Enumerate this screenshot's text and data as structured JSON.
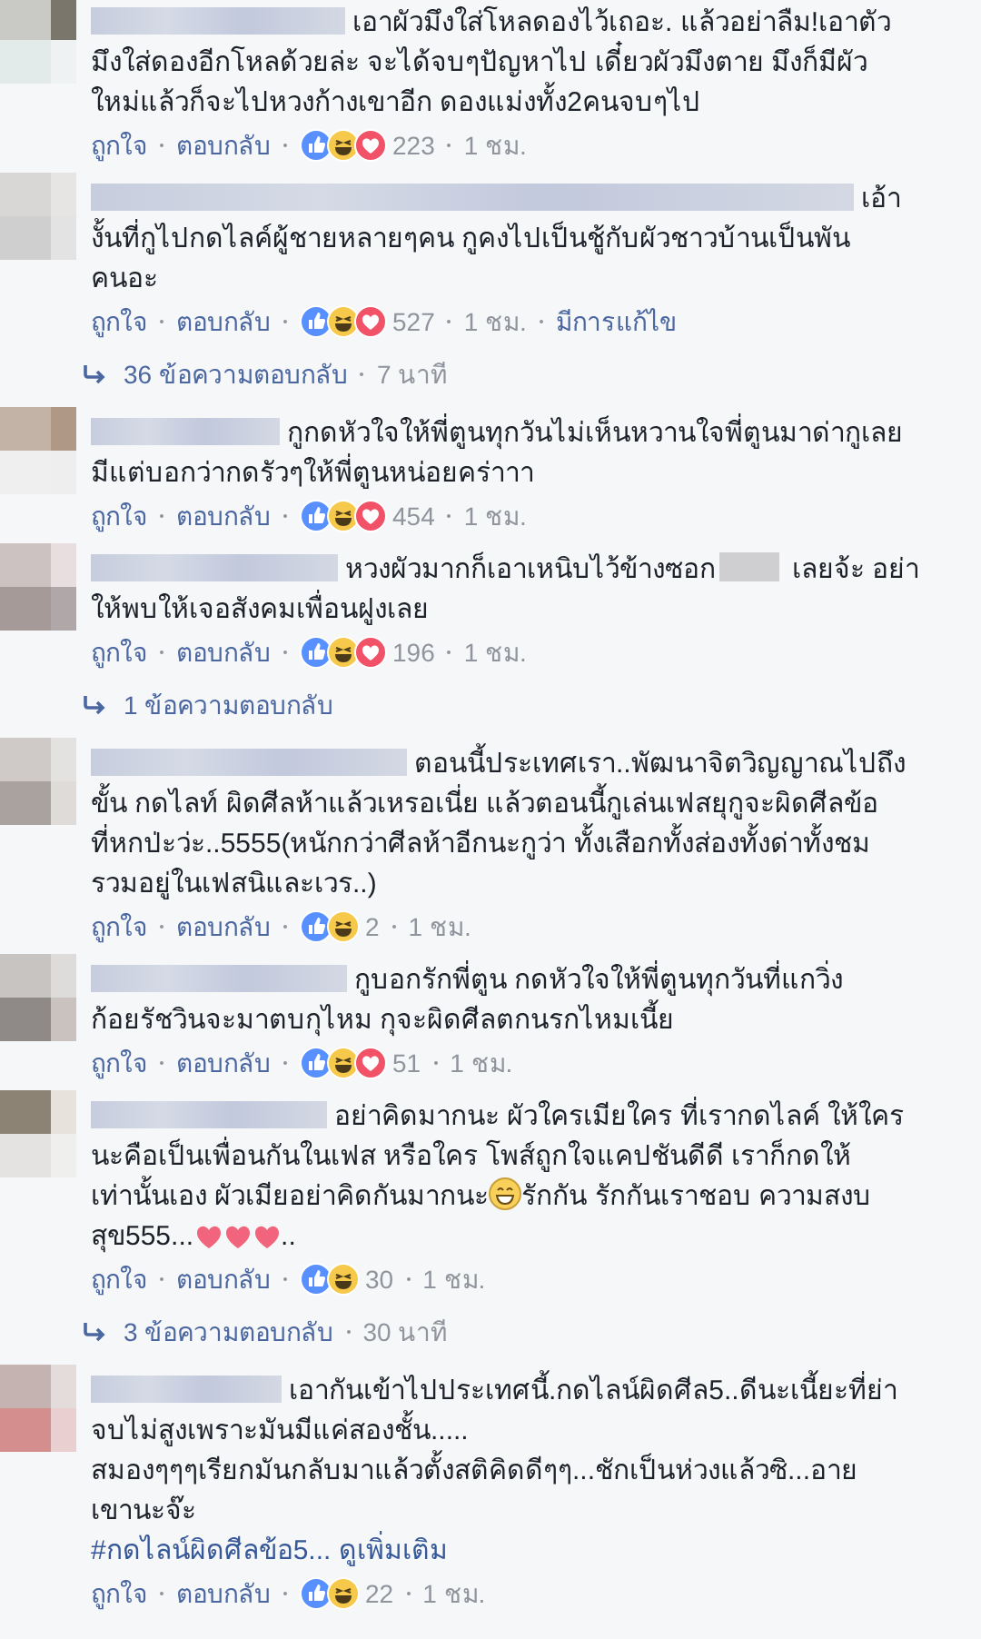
{
  "items": [
    {
      "kind": "comment",
      "lines": [
        [
          {
            "kind": "text",
            "text": "เอาผัวมึงใส่โหลดองไว้เถอะ. แล้วอย่าลืม!เอาตัว"
          }
        ],
        [
          {
            "kind": "text",
            "text": "มึงใส่ดองอีกโหลด้วยล่ะ จะได้จบๆปัญหาไป เดี๋ยวผัวมึงตาย มึงก็มีผัว"
          }
        ],
        [
          {
            "kind": "text",
            "text": "ใหม่แล้วก็จะไปหวงก้างเขาอีก ดองแม่งทั้ง2คนจบๆไป"
          }
        ]
      ],
      "like_label": "ถูกใจ",
      "reply_label": "ตอบกลับ",
      "reactions": [
        {
          "kind": "like"
        },
        {
          "kind": "haha"
        },
        {
          "kind": "love"
        }
      ],
      "count": "223",
      "time": "1 ชม."
    },
    {
      "kind": "comment",
      "lines": [
        [
          {
            "kind": "text",
            "text": "เอ้า"
          }
        ],
        [
          {
            "kind": "text",
            "text": "งั้นที่กูไปกดไลค์ผู้ชายหลายๆคน กูคงไปเป็นชู้กับผัวชาวบ้านเป็นพัน"
          }
        ],
        [
          {
            "kind": "text",
            "text": "คนอะ"
          }
        ]
      ],
      "like_label": "ถูกใจ",
      "reply_label": "ตอบกลับ",
      "reactions": [
        {
          "kind": "like"
        },
        {
          "kind": "haha"
        },
        {
          "kind": "love"
        }
      ],
      "count": "527",
      "time": "1 ชม.",
      "edited": "มีการแก้ไข"
    },
    {
      "kind": "replies",
      "label": "36 ข้อความตอบกลับ",
      "time": "7 นาที"
    },
    {
      "kind": "comment",
      "lines": [
        [
          {
            "kind": "text",
            "text": "กูกดหัวใจให้พี่ตูนทุกวันไม่เห็นหวานใจพี่ตูนมาด่ากูเลย"
          }
        ],
        [
          {
            "kind": "text",
            "text": "มีแต่บอกว่ากดรัวๆให้พี่ตูนหน่อยคร่าาา"
          }
        ]
      ],
      "like_label": "ถูกใจ",
      "reply_label": "ตอบกลับ",
      "reactions": [
        {
          "kind": "like"
        },
        {
          "kind": "haha"
        },
        {
          "kind": "love"
        }
      ],
      "count": "454",
      "time": "1 ชม."
    },
    {
      "kind": "comment",
      "lines": [
        [
          {
            "kind": "text",
            "text": "หวงผัวมากก็เอาเหนิบไว้ข้างซอก"
          },
          {
            "kind": "blur"
          },
          {
            "kind": "text",
            "text": "เลยจ้ะ อย่า"
          }
        ],
        [
          {
            "kind": "text",
            "text": "ให้พบให้เจอสังคมเพื่อนฝูงเลย"
          }
        ]
      ],
      "like_label": "ถูกใจ",
      "reply_label": "ตอบกลับ",
      "reactions": [
        {
          "kind": "like"
        },
        {
          "kind": "haha"
        },
        {
          "kind": "love"
        }
      ],
      "count": "196",
      "time": "1 ชม."
    },
    {
      "kind": "replies",
      "label": "1 ข้อความตอบกลับ"
    },
    {
      "kind": "comment",
      "lines": [
        [
          {
            "kind": "text",
            "text": "ตอนนี้ประเทศเรา..พัฒนาจิตวิญญาณไปถึง"
          }
        ],
        [
          {
            "kind": "text",
            "text": "ขั้น กดไลท์ ผิดศีลห้าแล้วเหรอเนี่ย แล้วตอนนี้กูเล่นเฟสยุกูจะผิดศีลข้อ"
          }
        ],
        [
          {
            "kind": "text",
            "text": "ที่หกป่ะว่ะ..5555(หนักกว่าศีลห้าอีกนะกูว่า ทั้งเสือกทั้งส่องทั้งด่าทั้งชม"
          }
        ],
        [
          {
            "kind": "text",
            "text": "รวมอยู่ในเฟสนิและเวร..)"
          }
        ]
      ],
      "like_label": "ถูกใจ",
      "reply_label": "ตอบกลับ",
      "reactions": [
        {
          "kind": "like"
        },
        {
          "kind": "haha"
        }
      ],
      "count": "2",
      "time": "1 ชม."
    },
    {
      "kind": "comment",
      "lines": [
        [
          {
            "kind": "text",
            "text": "กูบอกรักพี่ตูน กดหัวใจให้พี่ตูนทุกวันที่แกวิ่ง"
          }
        ],
        [
          {
            "kind": "text",
            "text": "ก้อยรัชวินจะมาตบกุไหม กุจะผิดศีลตกนรกไหมเนี้ย"
          }
        ]
      ],
      "like_label": "ถูกใจ",
      "reply_label": "ตอบกลับ",
      "reactions": [
        {
          "kind": "like"
        },
        {
          "kind": "haha"
        },
        {
          "kind": "love"
        }
      ],
      "count": "51",
      "time": "1 ชม."
    },
    {
      "kind": "comment",
      "lines": [
        [
          {
            "kind": "text",
            "text": "อย่าคิดมากนะ ผัวใครเมียใคร ที่เรากดไลค์ ให้ใคร"
          }
        ],
        [
          {
            "kind": "text",
            "text": "นะคือเป็นเพื่อนกันในเฟส หรือใคร โพส์ถูกใจแคปชันดีดี เราก็กดให้"
          }
        ],
        [
          {
            "kind": "text",
            "text": "เท่านั้นเอง ผัวเมียอย่าคิดกันมากนะ"
          },
          {
            "kind": "grin"
          },
          {
            "kind": "text",
            "text": "รักกัน รักกันเราชอบ ความสงบ"
          }
        ],
        [
          {
            "kind": "text",
            "text": "สุข555..."
          },
          {
            "kind": "heart"
          },
          {
            "kind": "heart"
          },
          {
            "kind": "heart"
          },
          {
            "kind": "text",
            "text": ".."
          }
        ]
      ],
      "like_label": "ถูกใจ",
      "reply_label": "ตอบกลับ",
      "reactions": [
        {
          "kind": "like"
        },
        {
          "kind": "haha"
        }
      ],
      "count": "30",
      "time": "1 ชม."
    },
    {
      "kind": "replies",
      "label": "3 ข้อความตอบกลับ",
      "time": "30 นาที"
    },
    {
      "kind": "comment",
      "lines": [
        [
          {
            "kind": "text",
            "text": "เอากันเข้าไปประเทศนี้.กดไลน์ผิดศีล5..ดีนะเนี้ยะที่ย่า"
          }
        ],
        [
          {
            "kind": "text",
            "text": "จบไม่สูงเพราะมันมีแค่สองชั้น....."
          }
        ],
        [
          {
            "kind": "text",
            "text": "สมองๆๆๆเรียกมันกลับมาแล้วตั้งสติคิดดีๆๆ...ชักเป็นห่วงแล้วซิ...อาย"
          }
        ],
        [
          {
            "kind": "text",
            "text": "เขานะจ๊ะ"
          }
        ]
      ],
      "hashtag": "#กดไลน์ผิดศีลข้อ5...",
      "see_more": "ดูเพิ่มเติม",
      "like_label": "ถูกใจ",
      "reply_label": "ตอบกลับ",
      "reactions": [
        {
          "kind": "like"
        },
        {
          "kind": "haha"
        }
      ],
      "count": "22",
      "time": "1 ชม."
    }
  ]
}
